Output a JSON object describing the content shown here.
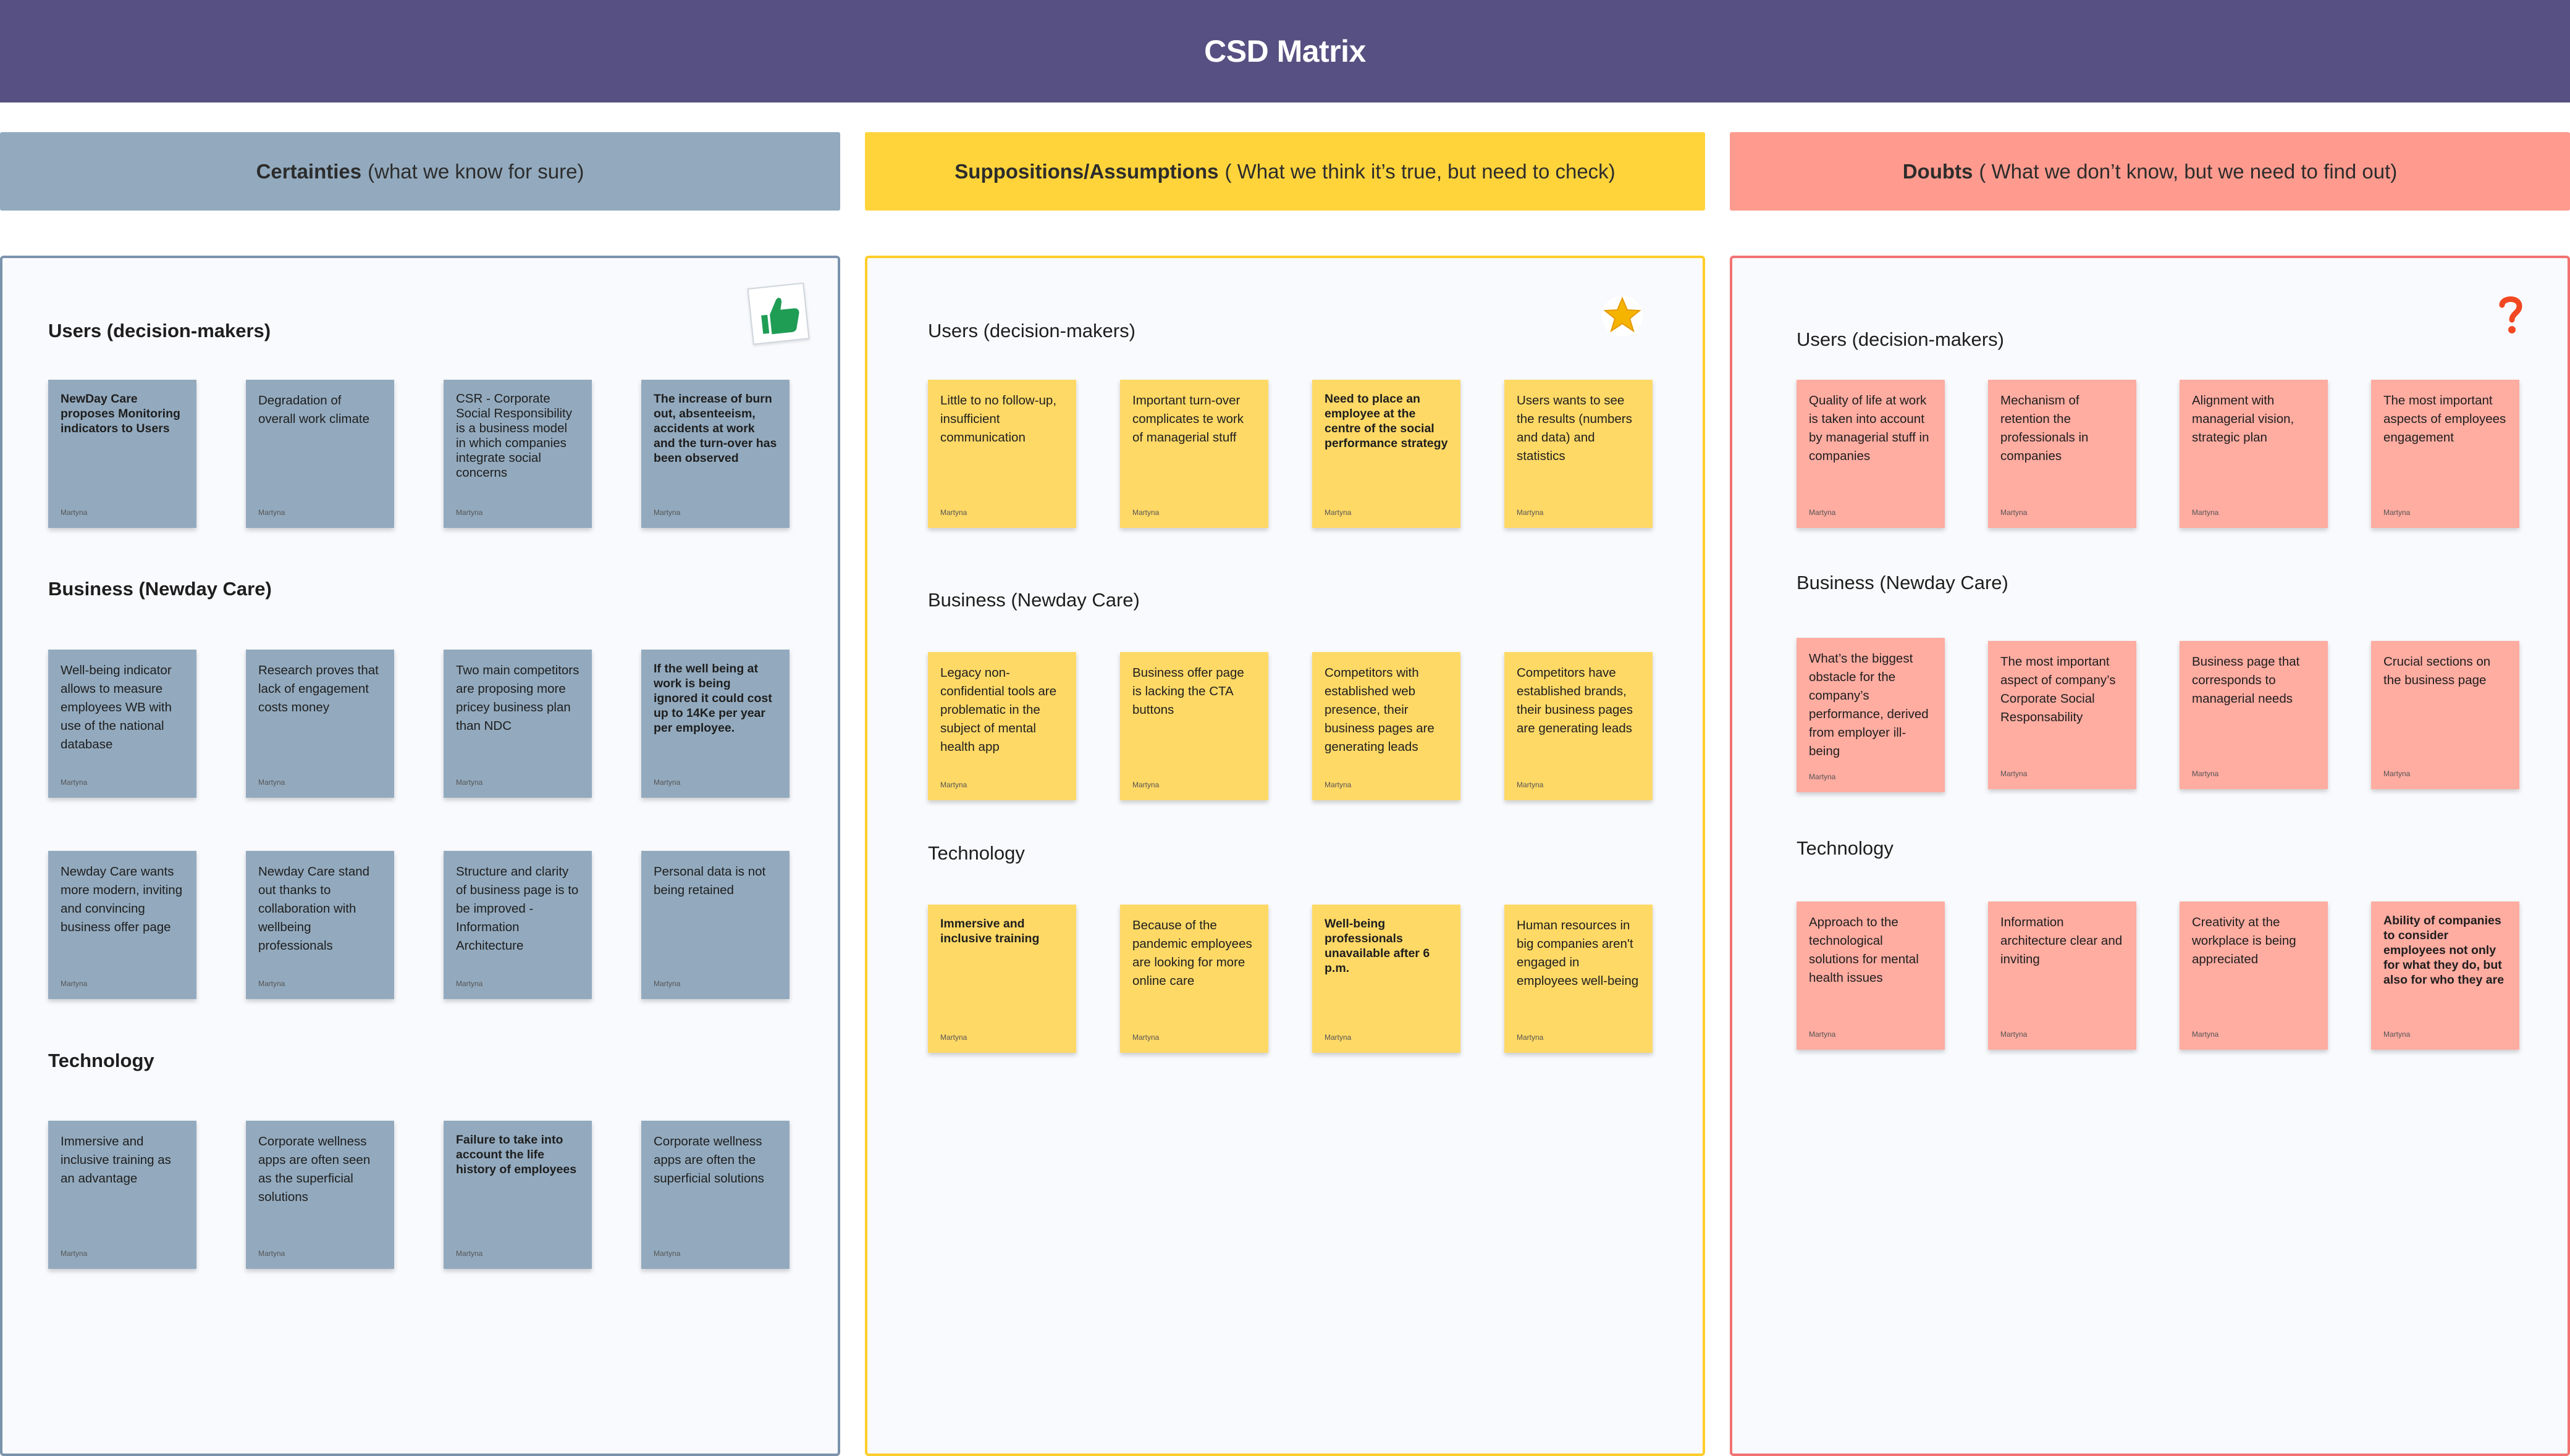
{
  "title": "CSD Matrix",
  "colors": {
    "header": "#575082",
    "certainties": "#93aabe",
    "suppositions": "#ffd43b",
    "doubts": "#ff9b8e"
  },
  "columns": {
    "certainties": {
      "header_bold": "Certainties",
      "header_rest": "(what we know for sure)",
      "sticker": "thumbs-up-icon",
      "sections": {
        "users": "Users (decision-makers)",
        "business": "Business (Newday Care)",
        "technology": "Technology"
      },
      "notes": [
        {
          "text": "NewDay Care proposes Monitoring indicators to Users",
          "author": "Martyna"
        },
        {
          "text": "Degradation of overall work climate",
          "author": "Martyna"
        },
        {
          "text": "CSR - Corporate Social Responsibility is a business model in which companies integrate social concerns",
          "author": "Martyna"
        },
        {
          "text": "The increase of burn out, absenteeism, accidents at work and the turn-over has been observed",
          "author": "Martyna"
        },
        {
          "text": "Well-being indicator allows to measure employees WB with use of the national database",
          "author": "Martyna"
        },
        {
          "text": "Research proves that lack of engagement costs money",
          "author": "Martyna"
        },
        {
          "text": "Two main competitors are proposing more pricey business plan than NDC",
          "author": "Martyna"
        },
        {
          "text": "If the well being at work is being ignored it could cost up to 14Ke per year per employee.",
          "author": "Martyna"
        },
        {
          "text": "Newday Care wants more modern, inviting and convincing business offer page",
          "author": "Martyna"
        },
        {
          "text": "Newday Care stand out thanks to collaboration with wellbeing professionals",
          "author": "Martyna"
        },
        {
          "text": "Structure and clarity of business page is to be improved - Information Architecture",
          "author": "Martyna"
        },
        {
          "text": "Personal data is not being retained",
          "author": "Martyna"
        },
        {
          "text": "Immersive and inclusive training as an advantage",
          "author": "Martyna"
        },
        {
          "text": "Corporate wellness apps are often seen as the superficial solutions",
          "author": "Martyna"
        },
        {
          "text": "Failure to take into account the life history of employees",
          "author": "Martyna"
        },
        {
          "text": "Corporate wellness apps are often the superficial solutions",
          "author": "Martyna"
        }
      ]
    },
    "suppositions": {
      "header_bold": "Suppositions/Assumptions",
      "header_rest": "( What we think it’s true, but need to check)",
      "sticker": "star-icon",
      "sections": {
        "users": "Users (decision-makers)",
        "business": "Business (Newday Care)",
        "technology": "Technology"
      },
      "notes": [
        {
          "text": "Little to no follow-up, insufficient communication",
          "author": "Martyna"
        },
        {
          "text": "Important turn-over complicates te work of managerial stuff",
          "author": "Martyna"
        },
        {
          "text": "Need to place an employee at the centre of the social performance strategy",
          "author": "Martyna"
        },
        {
          "text": "Users wants to see the results (numbers and data) and statistics",
          "author": "Martyna"
        },
        {
          "text": "Legacy non-confidential tools are problematic in the subject of mental health app",
          "author": "Martyna"
        },
        {
          "text": "Business offer page is lacking the CTA buttons",
          "author": "Martyna"
        },
        {
          "text": "Competitors with established web presence, their business pages are generating leads",
          "author": "Martyna"
        },
        {
          "text": "Competitors have established brands, their business pages are generating leads",
          "author": "Martyna"
        },
        {
          "text": "Immersive and inclusive training",
          "author": "Martyna"
        },
        {
          "text": "Because of the pandemic employees are looking for more online care",
          "author": "Martyna"
        },
        {
          "text": "Well-being professionals unavailable after 6 p.m.",
          "author": "Martyna"
        },
        {
          "text": "Human resources in big companies aren't engaged in employees well-being",
          "author": "Martyna"
        }
      ]
    },
    "doubts": {
      "header_bold": "Doubts",
      "header_rest": "( What we don’t know, but we need to find out)",
      "sticker": "question-mark-icon",
      "sections": {
        "users": "Users (decision-makers)",
        "business": "Business (Newday Care)",
        "technology": "Technology"
      },
      "notes": [
        {
          "text": "Quality of life at work is taken into account by managerial stuff in companies",
          "author": "Martyna"
        },
        {
          "text": "Mechanism of retention the professionals in companies",
          "author": "Martyna"
        },
        {
          "text": "Alignment with managerial vision, strategic plan",
          "author": "Martyna"
        },
        {
          "text": "The most important aspects of employees engagement",
          "author": "Martyna"
        },
        {
          "text": "What’s the biggest obstacle for the company’s performance, derived from employer ill-being",
          "author": "Martyna"
        },
        {
          "text": "The most important aspect of company’s Corporate Social Responsability",
          "author": "Martyna"
        },
        {
          "text": "Business page that corresponds to managerial needs",
          "author": "Martyna"
        },
        {
          "text": "Crucial sections on the business page",
          "author": "Martyna"
        },
        {
          "text": "Approach to the technological solutions for mental health issues",
          "author": "Martyna"
        },
        {
          "text": "Information architecture clear and inviting",
          "author": "Martyna"
        },
        {
          "text": "Creativity at the workplace is being appreciated",
          "author": "Martyna"
        },
        {
          "text": "Ability of companies to consider employees not only for what they do, but also for who they are",
          "author": "Martyna"
        }
      ]
    }
  }
}
